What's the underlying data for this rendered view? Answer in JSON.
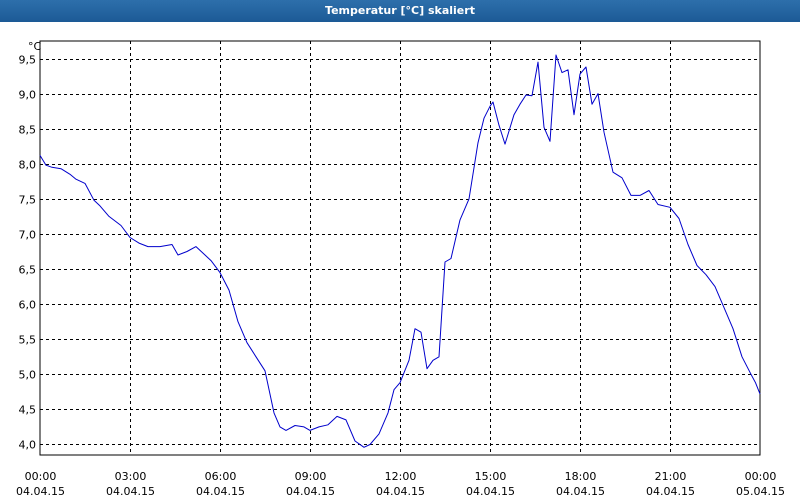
{
  "window": {
    "title": "Temperatur [°C] skaliert"
  },
  "chart_data": {
    "type": "line",
    "title": "Temperatur [°C] skaliert",
    "ylabel": "°C",
    "xlabel": "",
    "ylim": [
      3.85,
      9.75
    ],
    "xlim": [
      0,
      24
    ],
    "grid": true,
    "line_color": "#0000cc",
    "y_ticks": [
      {
        "value": 4.0,
        "label": "4,0"
      },
      {
        "value": 4.5,
        "label": "4,5"
      },
      {
        "value": 5.0,
        "label": "5,0"
      },
      {
        "value": 5.5,
        "label": "5,5"
      },
      {
        "value": 6.0,
        "label": "6,0"
      },
      {
        "value": 6.5,
        "label": "6,5"
      },
      {
        "value": 7.0,
        "label": "7,0"
      },
      {
        "value": 7.5,
        "label": "7,5"
      },
      {
        "value": 8.0,
        "label": "8,0"
      },
      {
        "value": 8.5,
        "label": "8,5"
      },
      {
        "value": 9.0,
        "label": "9,0"
      },
      {
        "value": 9.5,
        "label": "9,5"
      }
    ],
    "x_ticks": [
      {
        "value": 0,
        "time": "00:00",
        "date": "04.04.15"
      },
      {
        "value": 3,
        "time": "03:00",
        "date": "04.04.15"
      },
      {
        "value": 6,
        "time": "06:00",
        "date": "04.04.15"
      },
      {
        "value": 9,
        "time": "09:00",
        "date": "04.04.15"
      },
      {
        "value": 12,
        "time": "12:00",
        "date": "04.04.15"
      },
      {
        "value": 15,
        "time": "15:00",
        "date": "04.04.15"
      },
      {
        "value": 18,
        "time": "18:00",
        "date": "04.04.15"
      },
      {
        "value": 21,
        "time": "21:00",
        "date": "04.04.15"
      },
      {
        "value": 24,
        "time": "00:00",
        "date": "05.04.15"
      }
    ],
    "series": [
      {
        "x": [
          0,
          0.2,
          0.4,
          0.7,
          1.0,
          1.2,
          1.5,
          1.8,
          2.0,
          2.3,
          2.7,
          3.0,
          3.3,
          3.6,
          4.0,
          4.4,
          4.6,
          4.9,
          5.2,
          5.5,
          5.7,
          6.0,
          6.3,
          6.6,
          6.9,
          7.2,
          7.5,
          7.8,
          8.0,
          8.2,
          8.5,
          8.8,
          9.0,
          9.3,
          9.6,
          9.9,
          10.2,
          10.5,
          10.8,
          11.0,
          11.3,
          11.6,
          11.8,
          12.0,
          12.3,
          12.5,
          12.7,
          12.9,
          13.1,
          13.3,
          13.5,
          13.7,
          14.0,
          14.3,
          14.6,
          14.8,
          15.0,
          15.1,
          15.3,
          15.5,
          15.8,
          16.0,
          16.2,
          16.4,
          16.6,
          16.8,
          17.0,
          17.2,
          17.4,
          17.6,
          17.8,
          18.0,
          18.2,
          18.4,
          18.6,
          18.8,
          19.1,
          19.4,
          19.7,
          20.0,
          20.3,
          20.6,
          21.0,
          21.3,
          21.6,
          21.9,
          22.2,
          22.5,
          22.8,
          23.1,
          23.4,
          23.7,
          23.85,
          24.0
        ],
        "y": [
          8.12,
          7.98,
          7.95,
          7.93,
          7.85,
          7.78,
          7.72,
          7.48,
          7.4,
          7.25,
          7.12,
          6.95,
          6.87,
          6.82,
          6.82,
          6.85,
          6.7,
          6.75,
          6.82,
          6.7,
          6.62,
          6.45,
          6.2,
          5.75,
          5.45,
          5.25,
          5.05,
          4.45,
          4.25,
          4.2,
          4.27,
          4.25,
          4.2,
          4.25,
          4.28,
          4.4,
          4.35,
          4.05,
          3.96,
          4.0,
          4.15,
          4.45,
          4.78,
          4.88,
          5.2,
          5.65,
          5.6,
          5.08,
          5.2,
          5.25,
          6.6,
          6.65,
          7.2,
          7.5,
          8.3,
          8.65,
          8.82,
          8.88,
          8.55,
          8.28,
          8.7,
          8.85,
          8.98,
          8.97,
          9.45,
          8.52,
          8.32,
          9.55,
          9.3,
          9.34,
          8.7,
          9.28,
          9.38,
          8.85,
          9.0,
          8.45,
          7.88,
          7.8,
          7.55,
          7.55,
          7.62,
          7.42,
          7.38,
          7.22,
          6.85,
          6.55,
          6.42,
          6.25,
          5.95,
          5.65,
          5.25,
          5.0,
          4.88,
          4.72
        ]
      }
    ]
  }
}
